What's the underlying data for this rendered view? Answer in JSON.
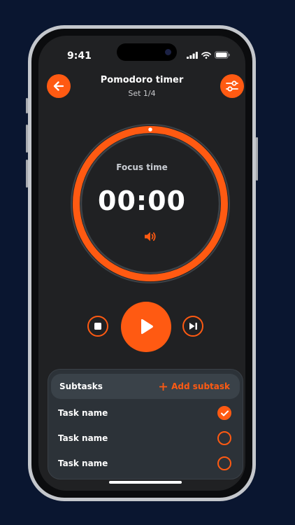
{
  "status_bar": {
    "time": "9:41"
  },
  "header": {
    "title": "Pomodoro timer",
    "subtitle": "Set 1/4"
  },
  "timer": {
    "label": "Focus time",
    "time": "00:00",
    "progress": 1.0
  },
  "subtasks": {
    "title": "Subtasks",
    "add_label": "Add subtask",
    "items": [
      {
        "name": "Task name",
        "done": true
      },
      {
        "name": "Task name",
        "done": false
      },
      {
        "name": "Task name",
        "done": false
      }
    ]
  },
  "colors": {
    "accent": "#ff5a12",
    "background": "#0a1630",
    "screen": "#202123",
    "card": "#2c3238"
  },
  "icons": [
    "arrow-left-icon",
    "sliders-icon",
    "speaker-icon",
    "stop-icon",
    "play-icon",
    "skip-next-icon",
    "plus-icon",
    "check-icon"
  ]
}
